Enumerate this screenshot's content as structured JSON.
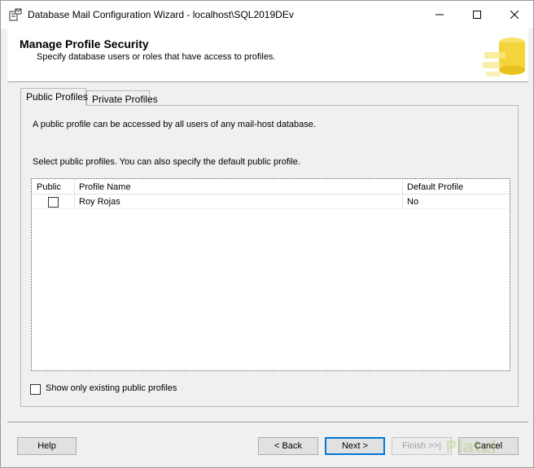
{
  "window": {
    "title": "Database Mail Configuration Wizard - localhost\\SQL2019DEv"
  },
  "header": {
    "title": "Manage Profile Security",
    "subtitle": "Specify database users or roles that have access to profiles."
  },
  "tabs": [
    {
      "label": "Public Profiles",
      "active": true
    },
    {
      "label": "Private Profiles",
      "active": false
    }
  ],
  "panel": {
    "description": "A public profile can be accessed by all users of any mail-host database.",
    "instruction": "Select public profiles. You can also specify the default public profile.",
    "grid": {
      "columns": [
        "Public",
        "Profile Name",
        "Default Profile"
      ],
      "rows": [
        {
          "public": false,
          "profile_name": "Roy Rojas",
          "default_profile": "No"
        }
      ]
    },
    "show_only_label": "Show only existing public profiles",
    "show_only_checked": false
  },
  "buttons": {
    "help": "Help",
    "back": "< Back",
    "next": "Next >",
    "finish": "Finish >>|",
    "cancel": "Cancel"
  },
  "watermark": "Platzi",
  "colors": {
    "focus_border": "#0078d7",
    "disabled_text": "#a0a0a0"
  }
}
